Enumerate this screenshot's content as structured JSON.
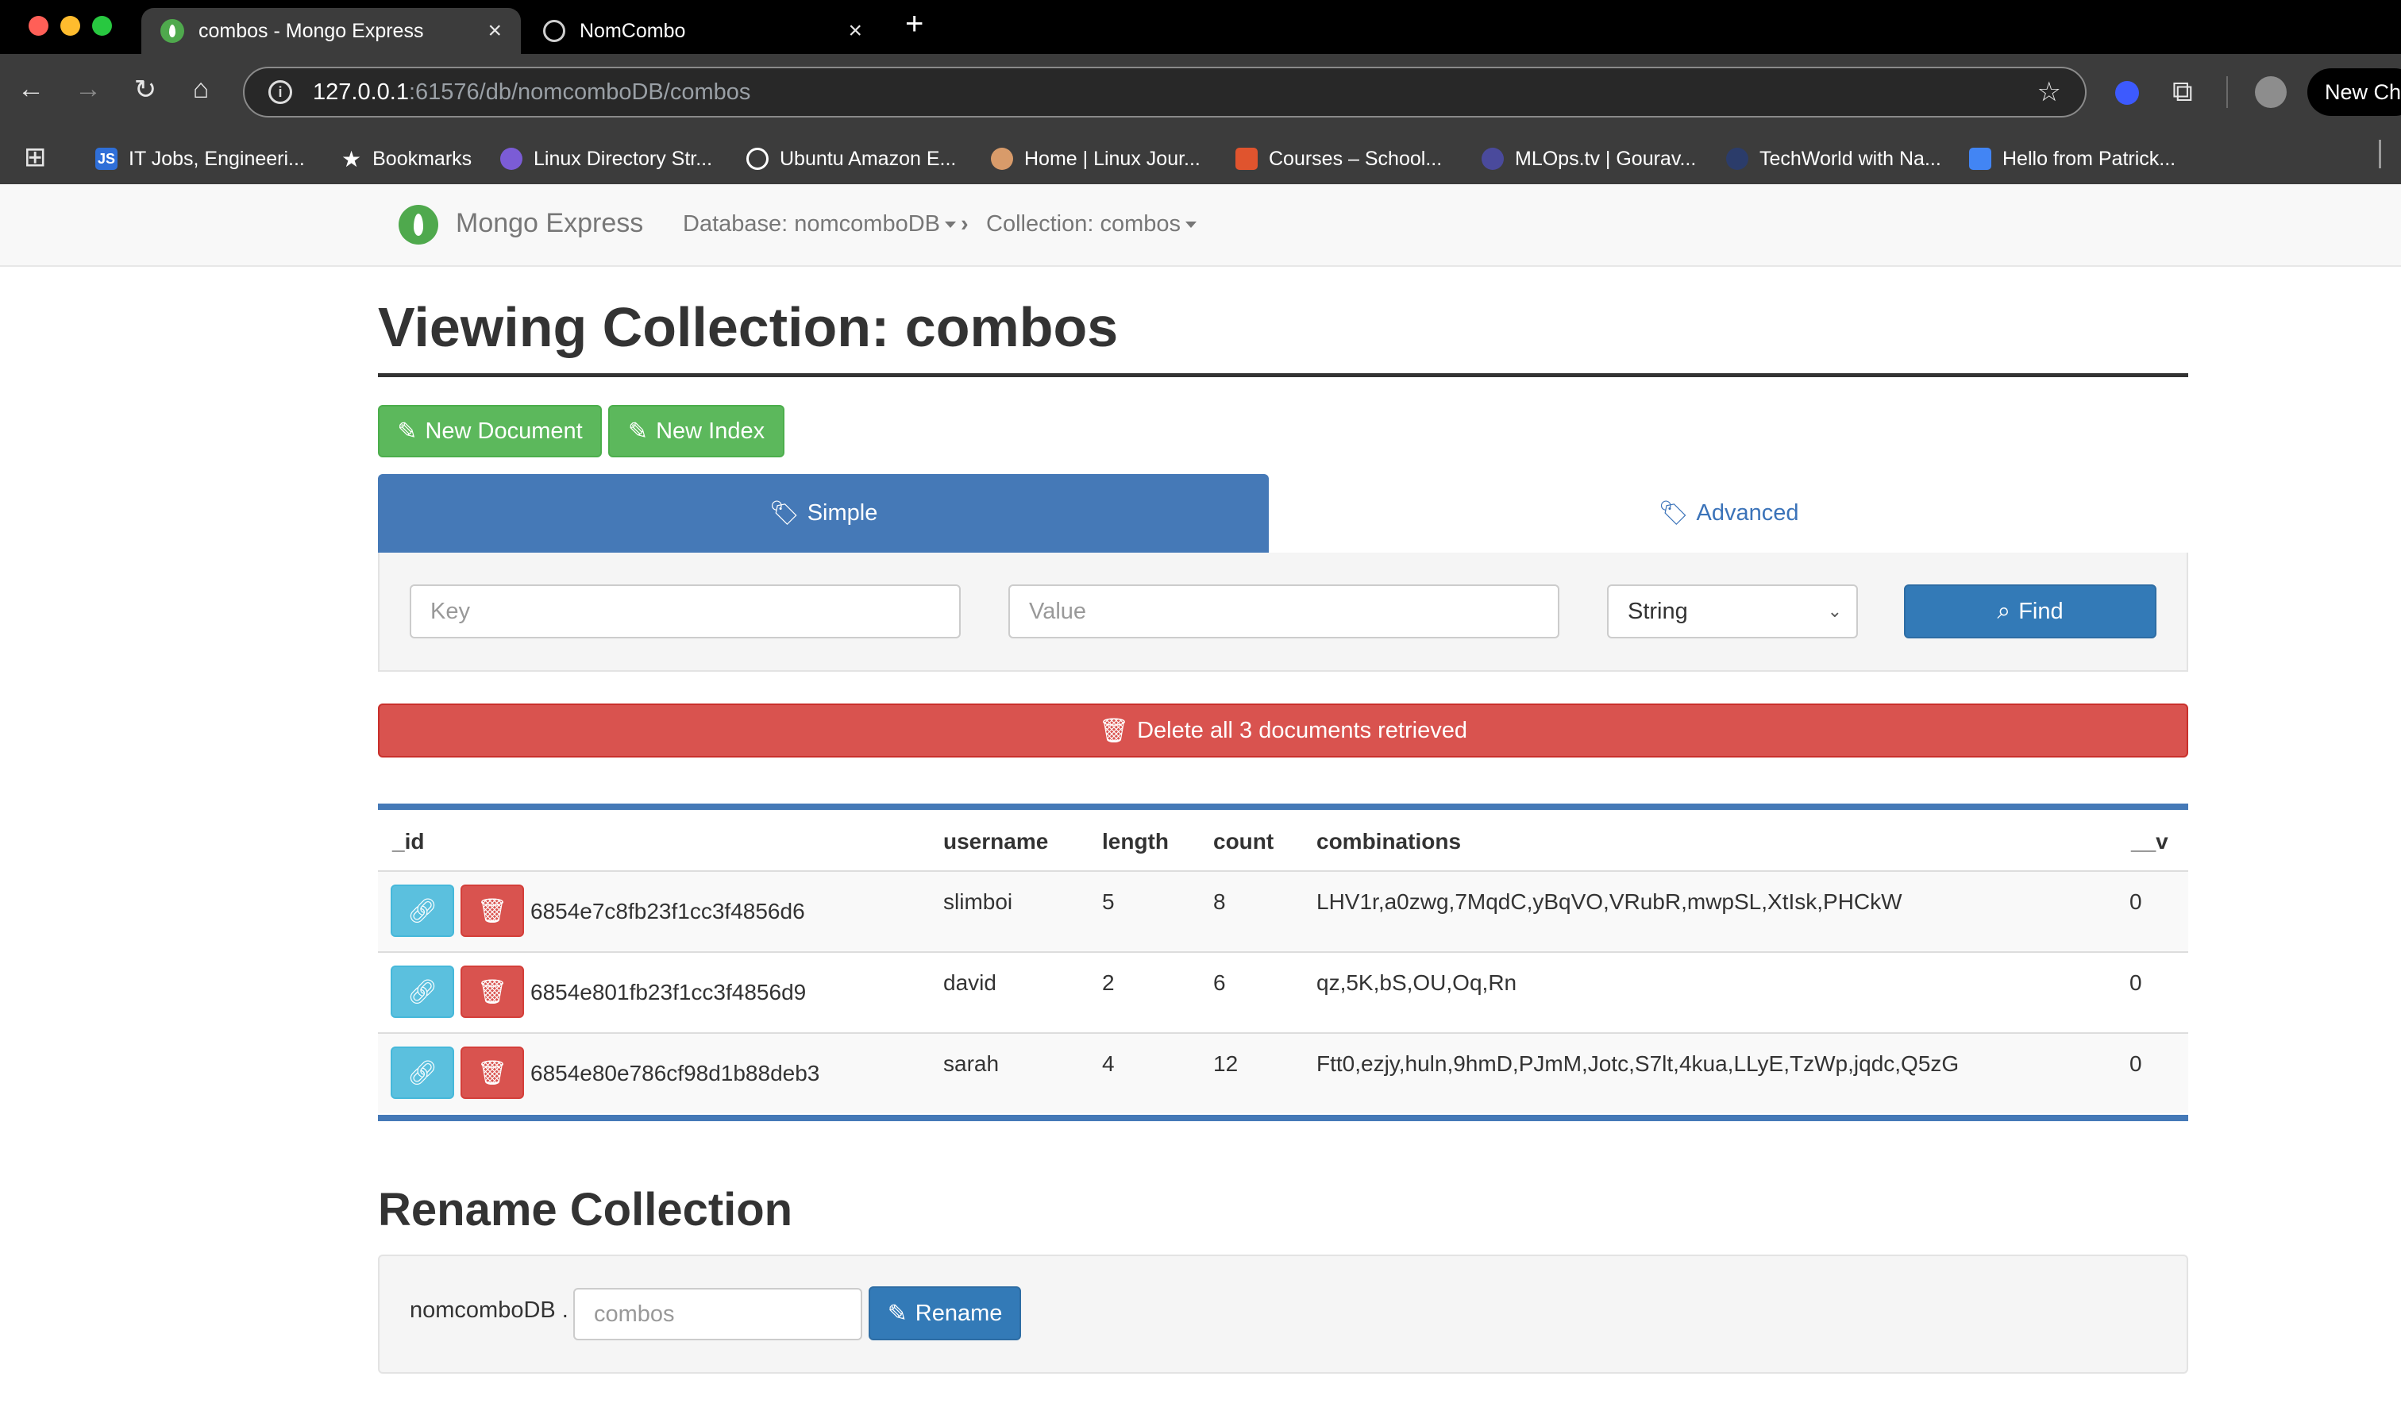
{
  "browser": {
    "tabs": [
      {
        "title": "combos - Mongo Express",
        "active": true
      },
      {
        "title": "NomCombo",
        "active": false
      }
    ],
    "url_host": "127.0.0.1",
    "url_rest": ":61576/db/nomcomboDB/combos",
    "profile_button": "New Ch",
    "bookmarks": [
      {
        "label": "IT Jobs, Engineeri...",
        "icon": "js-icon",
        "color": "#2f6fd8"
      },
      {
        "label": "Bookmarks",
        "icon": "star-icon",
        "color": "#ffffff"
      },
      {
        "label": "Linux Directory Str...",
        "icon": "linux-icon",
        "color": "#7b5cd6"
      },
      {
        "label": "Ubuntu Amazon E...",
        "icon": "globe-icon",
        "color": "#ffffff"
      },
      {
        "label": "Home | Linux Jour...",
        "icon": "linux-journey-icon",
        "color": "#d89b6a"
      },
      {
        "label": "Courses – School...",
        "icon": "courses-icon",
        "color": "#e0542e"
      },
      {
        "label": "MLOps.tv | Gourav...",
        "icon": "mlops-icon",
        "color": "#4a4a9c"
      },
      {
        "label": "TechWorld with Na...",
        "icon": "techworld-icon",
        "color": "#2b3c6a"
      },
      {
        "label": "Hello from Patrick...",
        "icon": "calendar-icon",
        "color": "#4285f4"
      }
    ]
  },
  "navbar": {
    "brand": "Mongo Express",
    "database": "Database: nomcomboDB",
    "collection": "Collection: combos"
  },
  "page": {
    "title": "Viewing Collection: combos",
    "new_document": "New Document",
    "new_index": "New Index",
    "tab_simple": "Simple",
    "tab_advanced": "Advanced",
    "key_placeholder": "Key",
    "value_placeholder": "Value",
    "type_selected": "String",
    "find": "Find",
    "delete_all": "Delete all 3 documents retrieved"
  },
  "table": {
    "headers": [
      "_id",
      "username",
      "length",
      "count",
      "combinations",
      "__v"
    ],
    "rows": [
      {
        "id": "6854e7c8fb23f1cc3f4856d6",
        "username": "slimboi",
        "length": "5",
        "count": "8",
        "combinations": "LHV1r,a0zwg,7MqdC,yBqVO,VRubR,mwpSL,XtIsk,PHCkW",
        "v": "0"
      },
      {
        "id": "6854e801fb23f1cc3f4856d9",
        "username": "david",
        "length": "2",
        "count": "6",
        "combinations": "qz,5K,bS,OU,Oq,Rn",
        "v": "0"
      },
      {
        "id": "6854e80e786cf98d1b88deb3",
        "username": "sarah",
        "length": "4",
        "count": "12",
        "combinations": "Ftt0,ezjy,huln,9hmD,PJmM,Jotc,S7lt,4kua,LLyE,TzWp,jqdc,Q5zG",
        "v": "0"
      }
    ]
  },
  "rename": {
    "title": "Rename Collection",
    "db_prefix": "nomcomboDB .",
    "placeholder": "combos",
    "button": "Rename"
  },
  "colors": {
    "primary": "#337ab7",
    "success": "#5cb85c",
    "danger": "#d9534f",
    "info": "#5bc0de",
    "tab_active": "#4579b7"
  }
}
